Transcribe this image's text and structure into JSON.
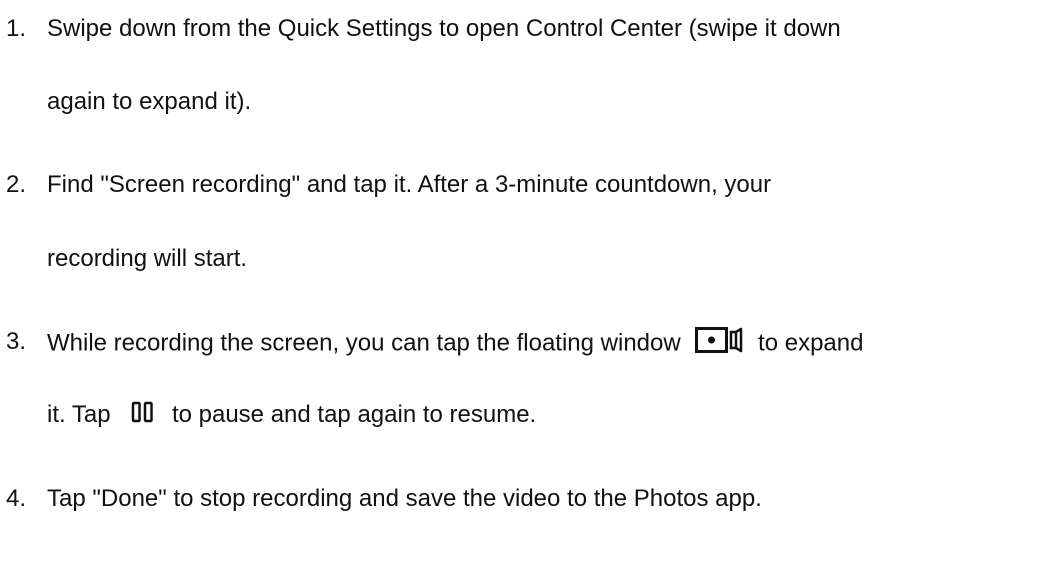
{
  "steps": [
    {
      "number": "1.",
      "line1": "Swipe down from the Quick Settings to open Control Center (swipe it down",
      "line2": "again to expand it)."
    },
    {
      "number": "2.",
      "line1": "Find \"Screen recording\" and tap it. After a 3-minute countdown, your",
      "line2": "recording will start."
    },
    {
      "number": "3.",
      "line1_before_icon": "While recording the screen, you can tap the floating window",
      "line1_icon": "floating-window-record-icon",
      "line1_after_icon": "to expand",
      "line2_before_icon": "it. Tap",
      "line2_icon": "pause-icon",
      "line2_after_icon": "to pause and tap again to resume."
    },
    {
      "number": "4.",
      "line1": "Tap \"Done\" to stop recording and save the video to the Photos app."
    }
  ]
}
